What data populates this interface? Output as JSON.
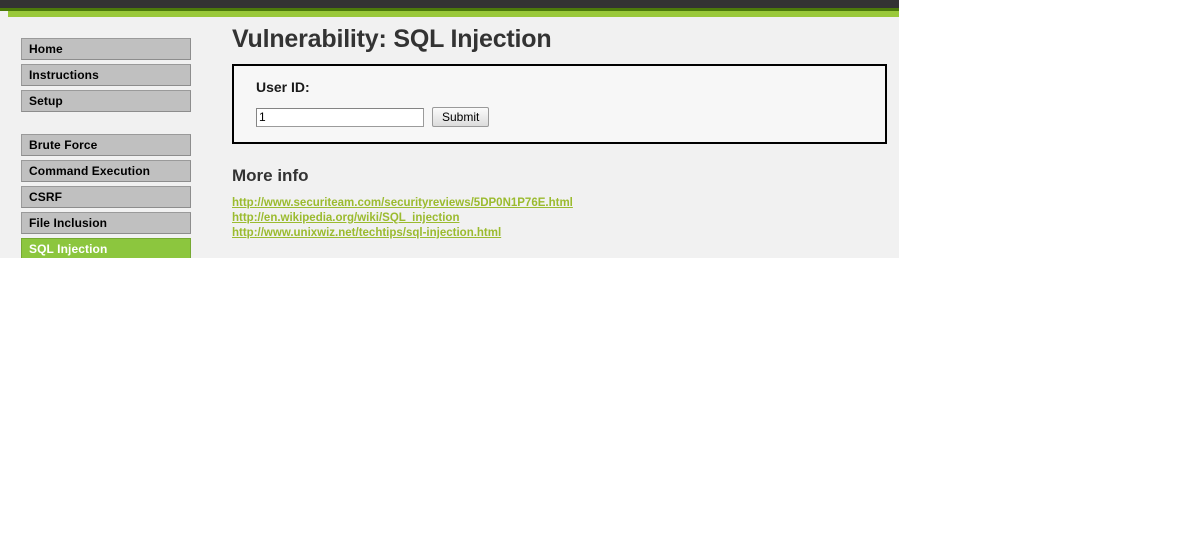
{
  "page": {
    "title": "Vulnerability: SQL Injection"
  },
  "theme": {
    "top_bar_dark": "#333333",
    "top_bar_green": "#9ac93a",
    "accent_green": "#8cc63e",
    "link_green": "#9bbb2f",
    "menu_gray": "#c0c0c0",
    "body_gray": "#f1f1f1"
  },
  "sidebar": {
    "groups": [
      {
        "items": [
          {
            "label": "Home",
            "active": false
          },
          {
            "label": "Instructions",
            "active": false
          },
          {
            "label": "Setup",
            "active": false
          }
        ]
      },
      {
        "items": [
          {
            "label": "Brute Force",
            "active": false
          },
          {
            "label": "Command Execution",
            "active": false
          },
          {
            "label": "CSRF",
            "active": false
          },
          {
            "label": "File Inclusion",
            "active": false
          },
          {
            "label": "SQL Injection",
            "active": true
          }
        ]
      }
    ]
  },
  "form": {
    "legend": "User ID:",
    "input_value": "1",
    "input_placeholder": "",
    "submit_label": "Submit"
  },
  "more_info": {
    "heading": "More info",
    "links": [
      "http://www.securiteam.com/securityreviews/5DP0N1P76E.html",
      "http://en.wikipedia.org/wiki/SQL_injection",
      "http://www.unixwiz.net/techtips/sql-injection.html"
    ]
  }
}
